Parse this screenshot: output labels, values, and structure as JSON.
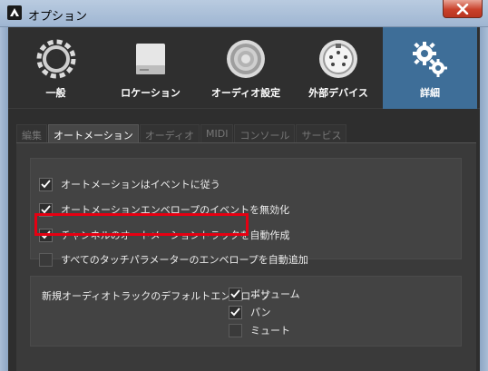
{
  "window": {
    "title": "オプション"
  },
  "categories": [
    {
      "label": "一般",
      "icon": "sync-icon",
      "active": false
    },
    {
      "label": "ロケーション",
      "icon": "drive-icon",
      "active": false
    },
    {
      "label": "オーディオ設定",
      "icon": "speaker-icon",
      "active": false
    },
    {
      "label": "外部デバイス",
      "icon": "midi-port-icon",
      "active": false
    },
    {
      "label": "詳細",
      "icon": "gears-icon",
      "active": true
    }
  ],
  "subtabs": [
    {
      "label": "編集",
      "active": false
    },
    {
      "label": "オートメーション",
      "active": true
    },
    {
      "label": "オーディオ",
      "active": false
    },
    {
      "label": "MIDI",
      "active": false
    },
    {
      "label": "コンソール",
      "active": false
    },
    {
      "label": "サービス",
      "active": false
    }
  ],
  "automation_options": [
    {
      "label": "オートメーションはイベントに従う",
      "checked": true
    },
    {
      "label": "オートメーションエンベロープのイベントを無効化",
      "checked": true
    },
    {
      "label": "チャンネルのオートメーショントラックを自動作成",
      "checked": true,
      "highlighted": true
    },
    {
      "label": "すべてのタッチパラメーターのエンベロープを自動追加",
      "checked": false
    }
  ],
  "default_envelopes": {
    "label": "新規オーディオトラックのデフォルトエンベロープ",
    "options": [
      {
        "label": "ボリューム",
        "checked": true
      },
      {
        "label": "パン",
        "checked": true
      },
      {
        "label": "ミュート",
        "checked": false
      }
    ]
  },
  "colors": {
    "active_category": "#3e6e98",
    "highlight": "#e60012"
  }
}
